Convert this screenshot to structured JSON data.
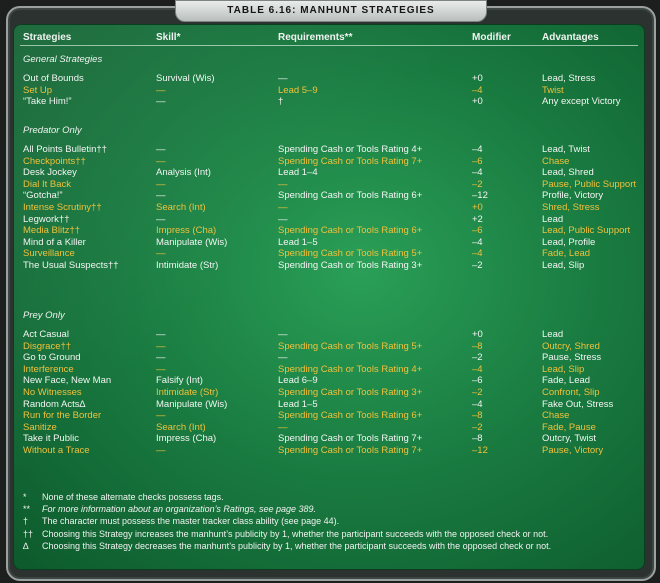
{
  "title": "TABLE 6.16: MANHUNT STRATEGIES",
  "headers": [
    "Strategies",
    "Skill*",
    "Requirements**",
    "Modifier",
    "Advantages"
  ],
  "sections": [
    {
      "label": "General Strategies",
      "rows": [
        {
          "strategy": "Out of Bounds",
          "skill": "Survival (Wis)",
          "requirements": "—",
          "modifier": "+0",
          "advantages": "Lead, Stress",
          "color": "white"
        },
        {
          "strategy": "Set Up",
          "skill": "—",
          "requirements": "Lead 5–9",
          "modifier": "–4",
          "advantages": "Twist",
          "color": "yellow"
        },
        {
          "strategy": "“Take Him!”",
          "skill": "—",
          "requirements": "†",
          "modifier": "+0",
          "advantages": "Any except Victory",
          "color": "white"
        }
      ]
    },
    {
      "label": "Predator Only",
      "rows": [
        {
          "strategy": "All Points Bulletin††",
          "skill": "—",
          "requirements": "Spending Cash or Tools Rating 4+",
          "modifier": "–4",
          "advantages": "Lead, Twist",
          "color": "white"
        },
        {
          "strategy": "Checkpoints††",
          "skill": "—",
          "requirements": "Spending Cash or Tools Rating 7+",
          "modifier": "–6",
          "advantages": "Chase",
          "color": "yellow"
        },
        {
          "strategy": "Desk Jockey",
          "skill": "Analysis (Int)",
          "requirements": "Lead 1–4",
          "modifier": "–4",
          "advantages": "Lead, Shred",
          "color": "white"
        },
        {
          "strategy": "Dial It Back",
          "skill": "—",
          "requirements": "—",
          "modifier": "–2",
          "advantages": "Pause, Public Support",
          "color": "yellow"
        },
        {
          "strategy": "“Gotcha!”",
          "skill": "—",
          "requirements": "Spending Cash or Tools Rating 6+",
          "modifier": "–12",
          "advantages": "Profile, Victory",
          "color": "white"
        },
        {
          "strategy": "Intense Scrutiny††",
          "skill": "Search (Int)",
          "requirements": "—",
          "modifier": "+0",
          "advantages": "Shred, Stress",
          "color": "yellow"
        },
        {
          "strategy": "Legwork††",
          "skill": "—",
          "requirements": "—",
          "modifier": "+2",
          "advantages": "Lead",
          "color": "white"
        },
        {
          "strategy": "Media Blitz††",
          "skill": "Impress (Cha)",
          "requirements": "Spending Cash or Tools Rating 6+",
          "modifier": "–6",
          "advantages": "Lead, Public Support",
          "color": "yellow"
        },
        {
          "strategy": "Mind of a Killer",
          "skill": "Manipulate (Wis)",
          "requirements": "Lead 1–5",
          "modifier": "–4",
          "advantages": "Lead, Profile",
          "color": "white"
        },
        {
          "strategy": "Surveillance",
          "skill": "—",
          "requirements": "Spending Cash or Tools Rating 5+",
          "modifier": "–4",
          "advantages": "Fade, Lead",
          "color": "yellow"
        },
        {
          "strategy": "The Usual Suspects††",
          "skill": "Intimidate (Str)",
          "requirements": "Spending Cash or Tools Rating 3+",
          "modifier": "–2",
          "advantages": "Lead, Slip",
          "color": "white"
        }
      ]
    },
    {
      "label": "Prey Only",
      "rows": [
        {
          "strategy": "Act Casual",
          "skill": "—",
          "requirements": "—",
          "modifier": "+0",
          "advantages": "Lead",
          "color": "white"
        },
        {
          "strategy": "Disgrace††",
          "skill": "—",
          "requirements": "Spending Cash or Tools Rating 5+",
          "modifier": "–8",
          "advantages": "Outcry, Shred",
          "color": "yellow"
        },
        {
          "strategy": "Go to Ground",
          "skill": "—",
          "requirements": "—",
          "modifier": "–2",
          "advantages": "Pause, Stress",
          "color": "white"
        },
        {
          "strategy": "Interference",
          "skill": "—",
          "requirements": "Spending Cash or Tools Rating 4+",
          "modifier": "–4",
          "advantages": "Lead, Slip",
          "color": "yellow"
        },
        {
          "strategy": "New Face, New Man",
          "skill": "Falsify (Int)",
          "requirements": "Lead 6–9",
          "modifier": "–6",
          "advantages": "Fade, Lead",
          "color": "white"
        },
        {
          "strategy": "No Witnesses",
          "skill": "Intimidate (Str)",
          "requirements": "Spending Cash or Tools Rating 3+",
          "modifier": "–2",
          "advantages": "Confront, Slip",
          "color": "yellow"
        },
        {
          "strategy": "Random Acts∆",
          "skill": "Manipulate (Wis)",
          "requirements": "Lead 1–5",
          "modifier": "–4",
          "advantages": "Fake Out, Stress",
          "color": "white"
        },
        {
          "strategy": "Run for the Border",
          "skill": "—",
          "requirements": "Spending Cash or Tools Rating 6+",
          "modifier": "–8",
          "advantages": "Chase",
          "color": "yellow"
        },
        {
          "strategy": "Sanitize",
          "skill": "Search (Int)",
          "requirements": "—",
          "modifier": "–2",
          "advantages": "Fade, Pause",
          "color": "yellow"
        },
        {
          "strategy": "Take it Public",
          "skill": "Impress (Cha)",
          "requirements": "Spending Cash or Tools Rating 7+",
          "modifier": "–8",
          "advantages": "Outcry, Twist",
          "color": "white"
        },
        {
          "strategy": "Without a Trace",
          "skill": "—",
          "requirements": "Spending Cash or Tools Rating 7+",
          "modifier": "–12",
          "advantages": "Pause, Victory",
          "color": "yellow"
        }
      ]
    }
  ],
  "footnotes": [
    {
      "mark": "*",
      "text": "None of these alternate checks possess tags.",
      "italic": false
    },
    {
      "mark": "**",
      "text": "For more information about an organization’s Ratings, see page 389.",
      "italic": true
    },
    {
      "mark": "†",
      "text": "The character must possess the master tracker class ability (see page 44).",
      "italic": false
    },
    {
      "mark": "††",
      "text": "Choosing this Strategy increases the manhunt’s publicity by 1, whether the participant succeeds with the opposed check or not.",
      "italic": false
    },
    {
      "mark": "∆",
      "text": "Choosing this Strategy decreases the manhunt’s publicity by 1, whether the participant succeeds with the opposed check or not.",
      "italic": false
    }
  ],
  "colors": {
    "white_text": "#f3f6f3",
    "yellow_text": "#f0c13c",
    "panel_green": "#1f8a48"
  }
}
